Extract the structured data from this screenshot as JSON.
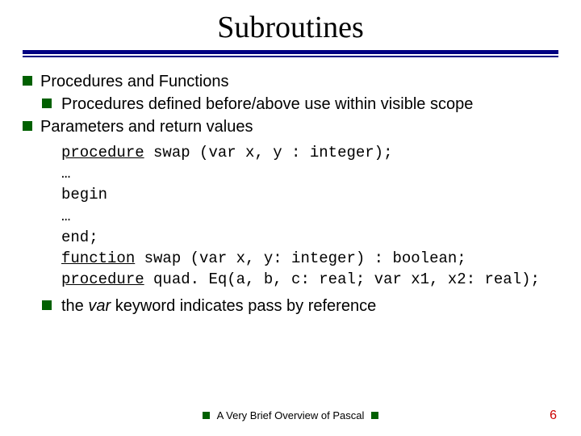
{
  "title": "Subroutines",
  "bullets": {
    "b1": "Procedures and Functions",
    "b1a": "Procedures defined before/above use within visible scope",
    "b2": "Parameters and return values",
    "b3_pre": "the ",
    "b3_kw": "var",
    "b3_post": " keyword indicates pass by reference"
  },
  "code": {
    "l1_kw": "procedure",
    "l1_rest": " swap (var x, y : integer);",
    "l2": "…",
    "l3": "begin",
    "l4": "…",
    "l5": "end;",
    "l6_kw": "function",
    "l6_rest": " swap (var x, y: integer) :  boolean;",
    "l7_kw": "procedure",
    "l7_rest": " quad. Eq(a, b, c: real; var x1, x2: real);"
  },
  "footer": "A Very Brief Overview of Pascal",
  "page": "6"
}
